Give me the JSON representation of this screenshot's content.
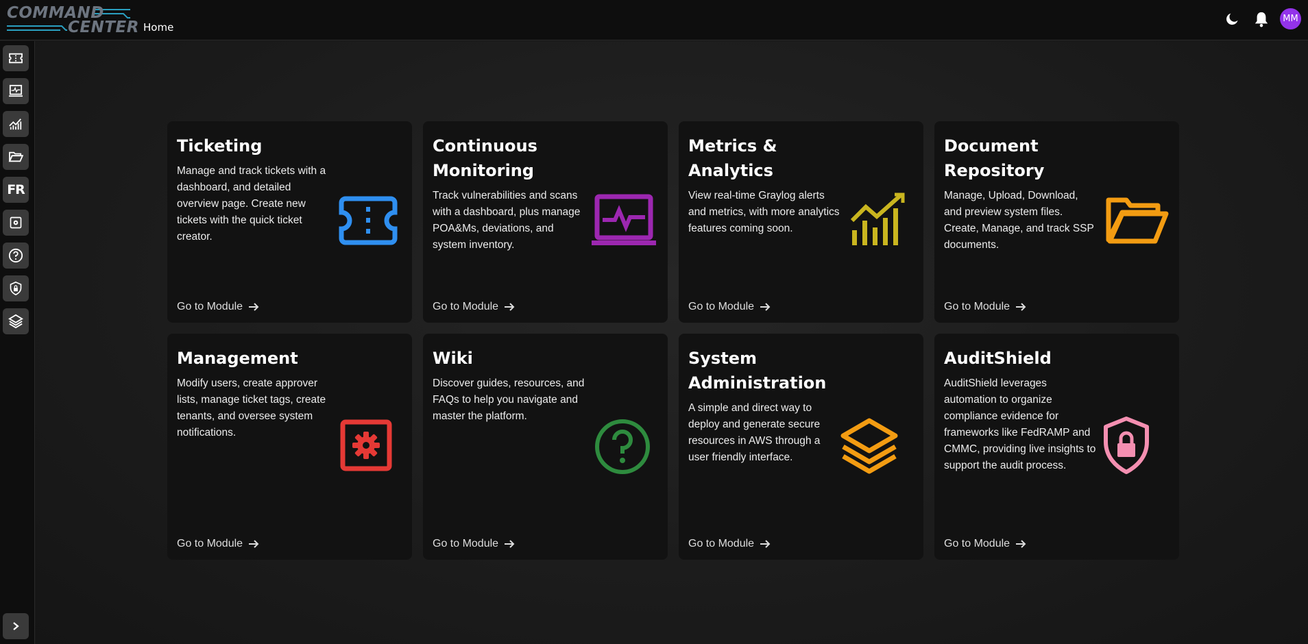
{
  "header": {
    "logo_line1": "COMMAND",
    "logo_line2": "CENTER",
    "breadcrumb": "Home",
    "avatar_initials": "MM",
    "theme_icon": "moon-icon",
    "notification_icon": "bell-icon"
  },
  "sidebar": {
    "items": [
      {
        "name": "ticket-icon"
      },
      {
        "name": "monitor-icon"
      },
      {
        "name": "chart-icon"
      },
      {
        "name": "folder-icon"
      },
      {
        "name": "fr-icon",
        "label": "FR"
      },
      {
        "name": "gear-icon"
      },
      {
        "name": "help-icon"
      },
      {
        "name": "shield-icon"
      },
      {
        "name": "layers-icon"
      }
    ],
    "expand_icon": "chevron-right-icon"
  },
  "modules": [
    {
      "title": "Ticketing",
      "description": "Manage and track tickets with a dashboard, and detailed overview page. Create new tickets with the quick ticket creator.",
      "link": "Go to Module",
      "icon": "ticket-icon",
      "color": "#2f8ff0"
    },
    {
      "title": "Continuous Monitoring",
      "description": "Track vulnerabilities and scans with a dashboard, plus manage POA&Ms, deviations, and system inventory.",
      "link": "Go to Module",
      "icon": "monitor-icon",
      "color": "#9c27b0"
    },
    {
      "title": "Metrics & Analytics",
      "description": "View real-time Graylog alerts and metrics, with more analytics features coming soon.",
      "link": "Go to Module",
      "icon": "chart-icon",
      "color": "#c9b51f"
    },
    {
      "title": "Document Repository",
      "description": "Manage, Upload, Download, and preview system files. Create, Manage, and track SSP documents.",
      "link": "Go to Module",
      "icon": "folder-icon",
      "color": "#f39c12"
    },
    {
      "title": "Management",
      "description": "Modify users, create approver lists, manage ticket tags, create tenants, and oversee system notifications.",
      "link": "Go to Module",
      "icon": "gear-icon",
      "color": "#e53935"
    },
    {
      "title": "Wiki",
      "description": "Discover guides, resources, and FAQs to help you navigate and master the platform.",
      "link": "Go to Module",
      "icon": "help-icon",
      "color": "#2e8b3e"
    },
    {
      "title": "System Administration",
      "description": "A simple and direct way to deploy and generate secure resources in AWS through a user friendly interface.",
      "link": "Go to Module",
      "icon": "layers-icon",
      "color": "#f39c12"
    },
    {
      "title": "AuditShield",
      "description": "AuditShield leverages automation to organize compliance evidence for frameworks like FedRAMP and CMMC, providing live insights to support the audit process.",
      "link": "Go to Module",
      "icon": "shield-lock-icon",
      "color": "#f48fb1"
    }
  ]
}
